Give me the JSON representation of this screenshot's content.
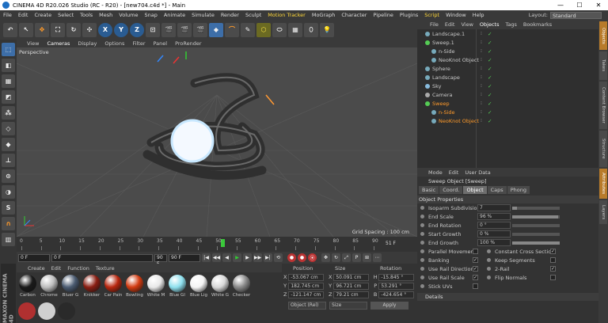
{
  "titlebar": {
    "title": "CINEMA 4D R20.026 Studio (RC - R20) - [new704.c4d *] - Main",
    "min": "—",
    "max": "☐",
    "close": "✕"
  },
  "menu": [
    "File",
    "Edit",
    "Create",
    "Select",
    "Tools",
    "Mesh",
    "Volume",
    "Snap",
    "Animate",
    "Simulate",
    "Render",
    "Sculpt",
    "Motion Tracker",
    "MoGraph",
    "Character",
    "Pipeline",
    "Plugins",
    "Script",
    "Window",
    "Help"
  ],
  "menu_highlight": [
    "Motion Tracker",
    "Script"
  ],
  "layout": {
    "label": "Layout:",
    "value": "Standard"
  },
  "toolbar": [
    "↶",
    "↖",
    "✥",
    "⛶",
    "↻",
    "✣",
    "X",
    "Y",
    "Z",
    "⊡",
    "🎬",
    "🎬",
    "🎬",
    "◆",
    "⌒",
    "✎",
    "⬡",
    "⬭",
    "▦",
    "⬯",
    "💡"
  ],
  "viewport": {
    "menu": [
      "View",
      "Cameras",
      "Display",
      "Options",
      "Filter",
      "Panel",
      "ProRender"
    ],
    "active_menu": "Cameras",
    "label": "Perspective",
    "grid_spacing": "Grid Spacing : 100 cm"
  },
  "timeline": {
    "ticks": [
      "0",
      "5",
      "10",
      "15",
      "20",
      "25",
      "30",
      "35",
      "40",
      "45",
      "50",
      "55",
      "60",
      "65",
      "70",
      "75",
      "80",
      "85",
      "90"
    ],
    "current_frame": "51 F",
    "current_frame_fraction": 0.567
  },
  "transport": {
    "start": "0 F",
    "cur": "0 F",
    "end": "90 F",
    "end2": "90 F",
    "buttons": [
      "|◀",
      "◀◀",
      "◀",
      "▶",
      "▶",
      "▶▶",
      "▶|",
      "⟲"
    ],
    "rec_buttons": [
      "●",
      "●",
      "⦿"
    ],
    "extra": [
      "✥",
      "↻",
      "⤢",
      "P",
      "⊞",
      "⋯"
    ]
  },
  "materials": {
    "menu": [
      "Create",
      "Edit",
      "Function",
      "Texture"
    ],
    "items": [
      {
        "label": "Carbon",
        "color": "#1a1a1a"
      },
      {
        "label": "Chrome",
        "color": "#bdbdbd"
      },
      {
        "label": "Bluer G",
        "color": "#4a5a70"
      },
      {
        "label": "Knikker",
        "color": "#8a1e12"
      },
      {
        "label": "Car Pain",
        "color": "#b8260e"
      },
      {
        "label": "Bowling",
        "color": "#d23a10"
      },
      {
        "label": "White M",
        "color": "#e8e8e8"
      },
      {
        "label": "Blue Gl",
        "color": "#8ee0ee"
      },
      {
        "label": "Blue Lig",
        "color": "#f4f4f4"
      },
      {
        "label": "White G",
        "color": "#d8d8d8"
      },
      {
        "label": "Checker",
        "color": "#888888"
      }
    ]
  },
  "coords": {
    "headers": [
      "Position",
      "Size",
      "Rotation"
    ],
    "rows": [
      {
        "pa": "X",
        "pv": "-53.067 cm",
        "sa": "X",
        "sv": "50.091 cm",
        "ra": "H",
        "rv": "-15.845 °"
      },
      {
        "pa": "Y",
        "pv": "182.745 cm",
        "sa": "Y",
        "sv": "96.721 cm",
        "ra": "P",
        "rv": "53.291 °"
      },
      {
        "pa": "Z",
        "pv": "-121.147 cm",
        "sa": "Z",
        "sv": "79.21 cm",
        "ra": "B",
        "rv": "-424.654 °"
      }
    ],
    "mode": "Object (Rel)",
    "size_mode": "Size",
    "apply": "Apply"
  },
  "objects": {
    "menu": [
      "File",
      "Edit",
      "View",
      "Objects",
      "Tags",
      "Bookmarks"
    ],
    "active_menu": "Objects",
    "items": [
      {
        "name": "Landscape.1",
        "indent": 0,
        "color": "#7ab",
        "sel": false
      },
      {
        "name": "Sweep.1",
        "indent": 0,
        "color": "#5c5",
        "sel": false
      },
      {
        "name": "n-Side",
        "indent": 1,
        "color": "#7ab",
        "sel": false
      },
      {
        "name": "NeoKnot Object",
        "indent": 1,
        "color": "#7ab",
        "sel": false
      },
      {
        "name": "Sphere",
        "indent": 0,
        "color": "#7ab",
        "sel": false
      },
      {
        "name": "Landscape",
        "indent": 0,
        "color": "#7ab",
        "sel": false
      },
      {
        "name": "Sky",
        "indent": 0,
        "color": "#8bd",
        "sel": false
      },
      {
        "name": "Camera",
        "indent": 0,
        "color": "#aaa",
        "sel": false
      },
      {
        "name": "Sweep",
        "indent": 0,
        "color": "#5c5",
        "sel": true
      },
      {
        "name": "n-Side",
        "indent": 1,
        "color": "#7ab",
        "sel": true
      },
      {
        "name": "NeoKnot Object",
        "indent": 1,
        "color": "#7ab",
        "sel": true
      }
    ]
  },
  "attributes": {
    "menu": [
      "Mode",
      "Edit",
      "User Data"
    ],
    "title": "Sweep Object [Sweep]",
    "tabs": [
      "Basic",
      "Coord.",
      "Object",
      "Caps",
      "Phong"
    ],
    "active_tab": "Object",
    "section": "Object Properties",
    "props": [
      {
        "label": "Isoparm Subdivision",
        "value": "7",
        "fill": 0.1
      },
      {
        "label": "End Scale",
        "value": "96 %",
        "fill": 0.96
      },
      {
        "label": "End Rotation",
        "value": "0 °",
        "fill": 0.0
      },
      {
        "label": "Start Growth",
        "value": "0 %",
        "fill": 0.0
      },
      {
        "label": "End Growth",
        "value": "100 %",
        "fill": 1.0
      }
    ],
    "checks_left": [
      {
        "label": "Parallel Movement",
        "checked": false
      },
      {
        "label": "Banking",
        "checked": true
      },
      {
        "label": "Use Rail Direction",
        "checked": true
      },
      {
        "label": "Use Rail Scale",
        "checked": true
      },
      {
        "label": "Stick UVs",
        "checked": false
      }
    ],
    "checks_right": [
      {
        "label": "Constant Cross Section",
        "checked": true
      },
      {
        "label": "Keep Segments",
        "checked": false
      },
      {
        "label": "2-Rail",
        "checked": true
      },
      {
        "label": "Flip Normals",
        "checked": false
      }
    ],
    "details": "Details"
  },
  "sidetabs": [
    "Objects",
    "Takes",
    "Content Browser",
    "Structure",
    "Attributes",
    "Layers"
  ],
  "brand": "MAXON CINEMA 4D"
}
